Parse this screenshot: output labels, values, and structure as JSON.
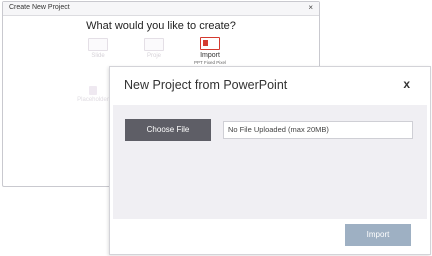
{
  "background_dialog": {
    "title": "Create New Project",
    "close": "×",
    "heading": "What would you like to create?",
    "options": [
      {
        "label": "Slide",
        "sub": "",
        "state": "faded"
      },
      {
        "label": "Proje",
        "sub": "",
        "state": "faded"
      },
      {
        "label": "Import",
        "sub": "PPT Fixed Pixel",
        "state": "active"
      },
      {
        "label": "Placeholder",
        "sub": "",
        "state": "faded"
      }
    ]
  },
  "modal": {
    "title": "New Project from PowerPoint",
    "close": "x",
    "choose_file_label": "Choose File",
    "file_status": "No File Uploaded (max 20MB)",
    "import_label": "Import"
  },
  "colors": {
    "choose_button": "#5e5e66",
    "import_button_disabled": "#9eb0c3",
    "body_bg": "#f0eff3",
    "import_icon_accent": "#d43a2f"
  },
  "icons": {
    "import_icon": "powerpoint-import-icon",
    "slide_icon": "slide-icon",
    "project_icon": "project-icon",
    "placeholder_icon": "placeholder-icon"
  }
}
